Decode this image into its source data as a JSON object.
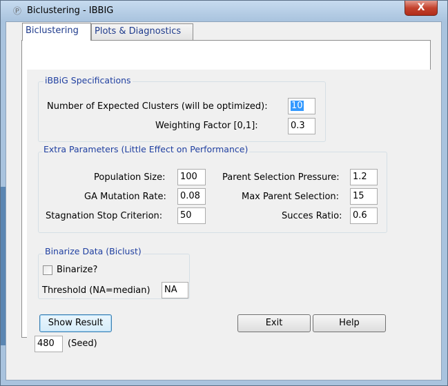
{
  "window": {
    "title": "Biclustering - IBBIG",
    "close_glyph": "X",
    "app_icon": "r-logo-icon"
  },
  "tabs": [
    {
      "label": "Biclustering",
      "active": true
    },
    {
      "label": "Plots & Diagnostics",
      "active": false
    }
  ],
  "spec_group": {
    "legend": "iBBiG Specifications",
    "clusters_label": "Number of Expected Clusters (will be optimized):",
    "clusters_value": "10",
    "weighting_label": "Weighting Factor [0,1]:",
    "weighting_value": "0.3"
  },
  "extra_group": {
    "legend": "Extra Parameters (Little Effect on Performance)",
    "population_label": "Population Size:",
    "population_value": "100",
    "mutation_label": "GA Mutation Rate:",
    "mutation_value": "0.08",
    "stagnation_label": "Stagnation Stop Criterion:",
    "stagnation_value": "50",
    "pressure_label": "Parent Selection Pressure:",
    "pressure_value": "1.2",
    "max_parent_label": "Max Parent Selection:",
    "max_parent_value": "15",
    "succes_label": "Succes Ratio:",
    "succes_value": "0.6"
  },
  "binarize_group": {
    "legend": "Binarize Data (Biclust)",
    "checkbox_label": "Binarize?",
    "checked": false,
    "threshold_label": "Threshold (NA=median)",
    "threshold_value": "NA"
  },
  "actions": {
    "show_result": "Show Result",
    "exit": "Exit",
    "help": "Help",
    "seed_value": "480",
    "seed_label": "(Seed)"
  }
}
